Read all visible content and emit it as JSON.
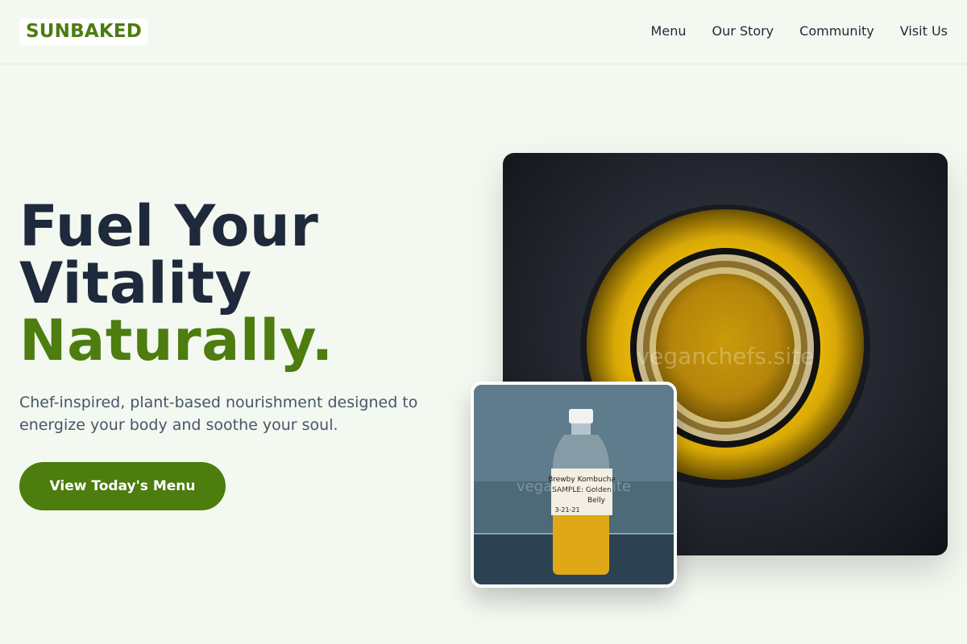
{
  "brand": {
    "logo": "SUNBAKED",
    "accent_color": "#4d7c0f"
  },
  "nav": {
    "items": [
      {
        "label": "Menu"
      },
      {
        "label": "Our Story"
      },
      {
        "label": "Community"
      },
      {
        "label": "Visit Us"
      }
    ]
  },
  "hero": {
    "title_line1": "Fuel Your",
    "title_line2": "Vitality",
    "title_accent": "Naturally.",
    "subtitle": "Chef-inspired, plant-based nourishment designed to energize your body and soothe your soul.",
    "cta_label": "View Today's Menu"
  },
  "images": {
    "main": {
      "subject": "jar-top-view",
      "watermark": "veganchefs.site"
    },
    "small": {
      "subject": "kombucha-bottle",
      "watermark": "veganchefs.site",
      "label_lines": [
        "Brewby Kombucha",
        "SAMPLE: Golden",
        "Belly",
        "3-21-21"
      ]
    }
  }
}
